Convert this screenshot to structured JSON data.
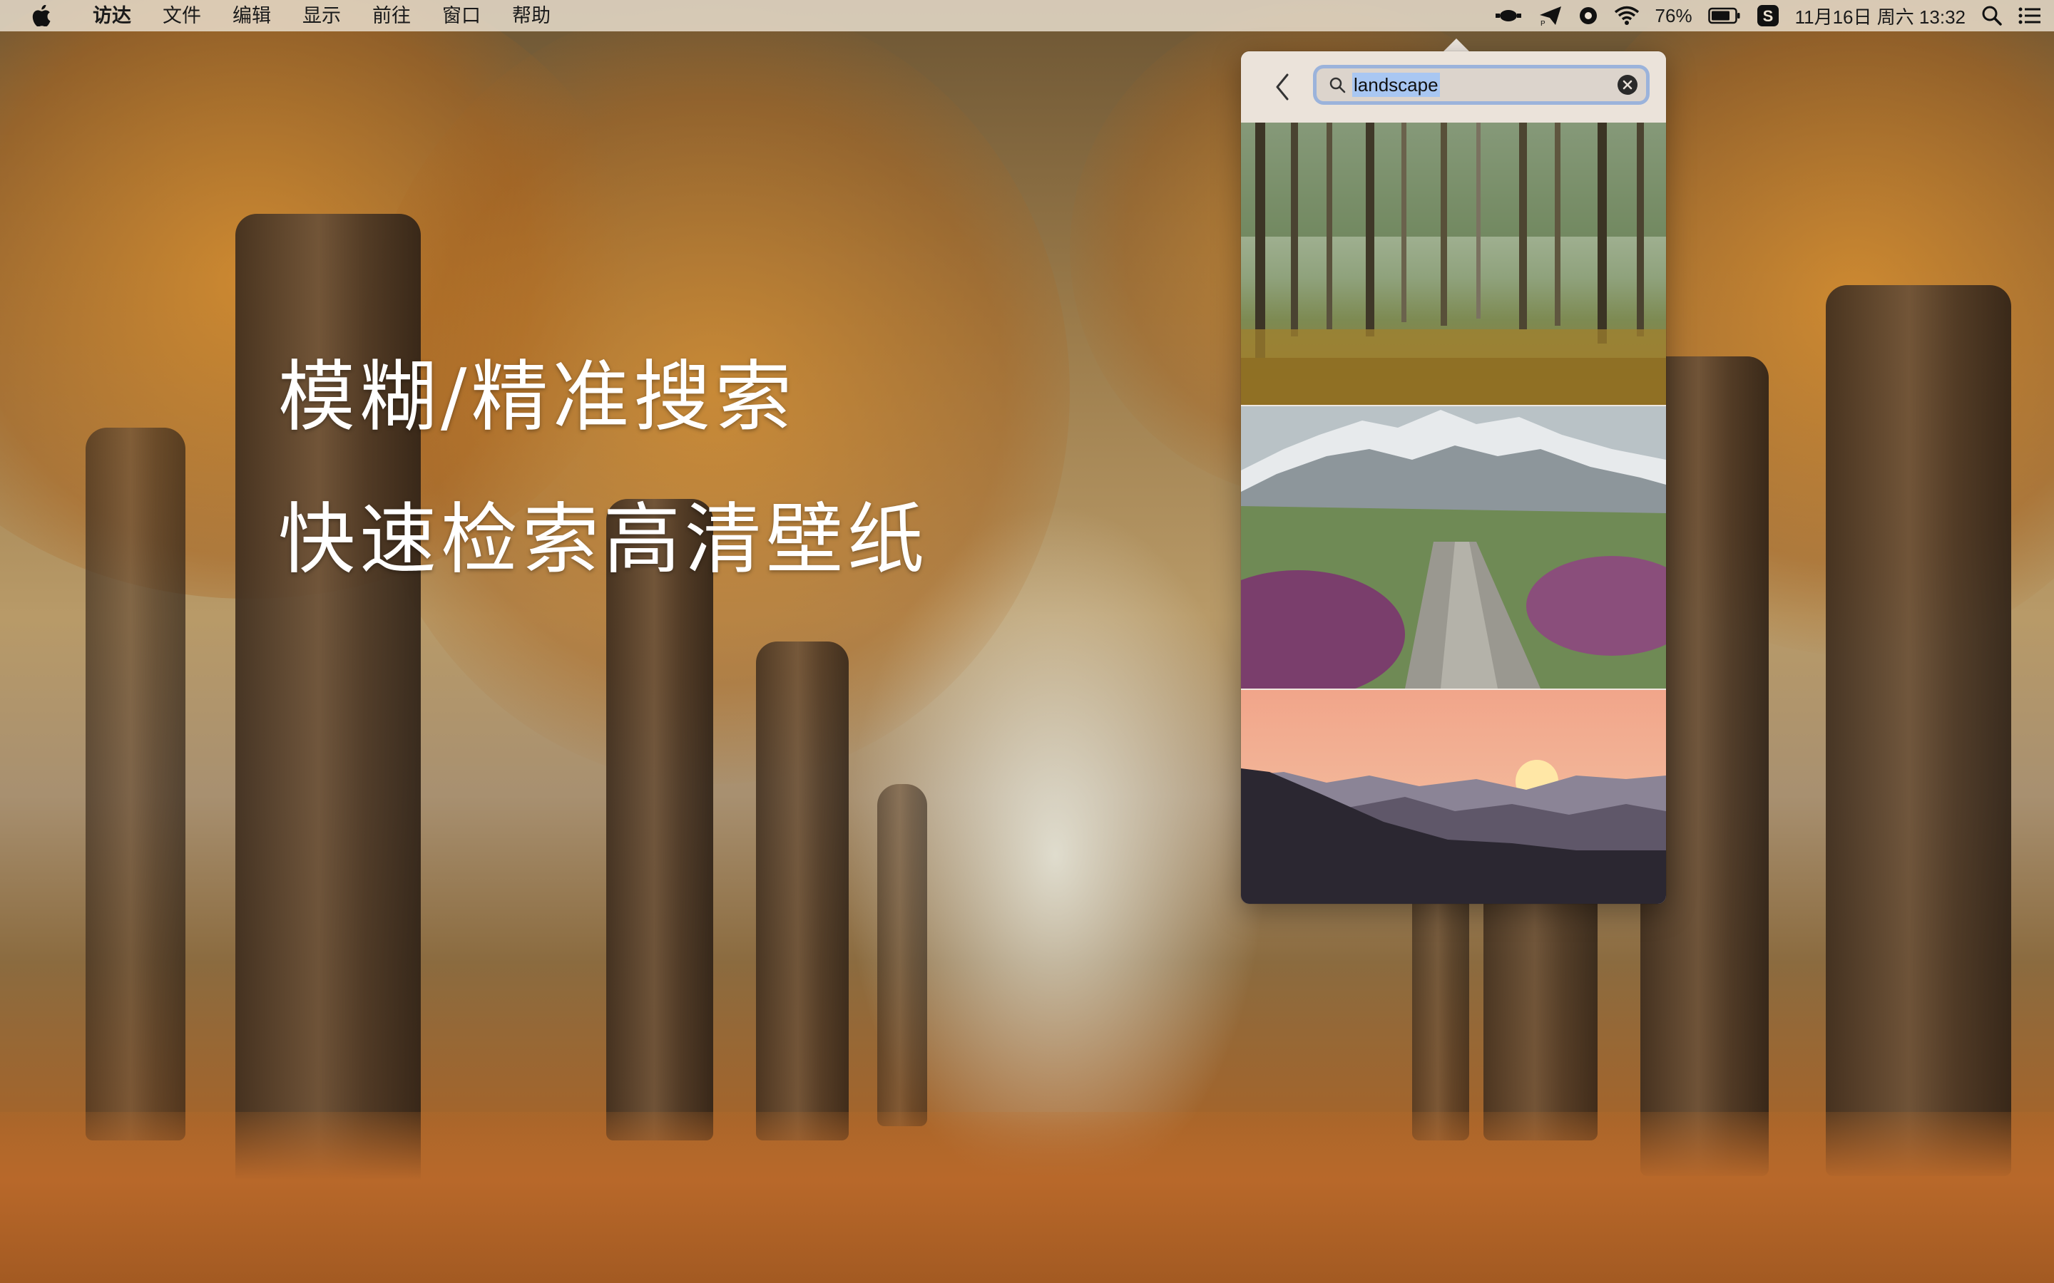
{
  "menubar": {
    "app_name": "访达",
    "items": [
      "文件",
      "编辑",
      "显示",
      "前往",
      "窗口",
      "帮助"
    ],
    "status": {
      "battery_percent": "76%",
      "datetime": "11月16日 周六 13:32"
    }
  },
  "overlay": {
    "line1": "模糊/精准搜索",
    "line2": "快速检索高清壁纸"
  },
  "popover": {
    "search_value": "landscape",
    "results": [
      {
        "icon": "forest-image"
      },
      {
        "icon": "mountain-path-image"
      },
      {
        "icon": "sunset-mountains-image"
      }
    ]
  },
  "colors": {
    "accent": "#5a8cdc",
    "selection": "#a9c7f2",
    "popover_bg": "#efe8e0"
  }
}
